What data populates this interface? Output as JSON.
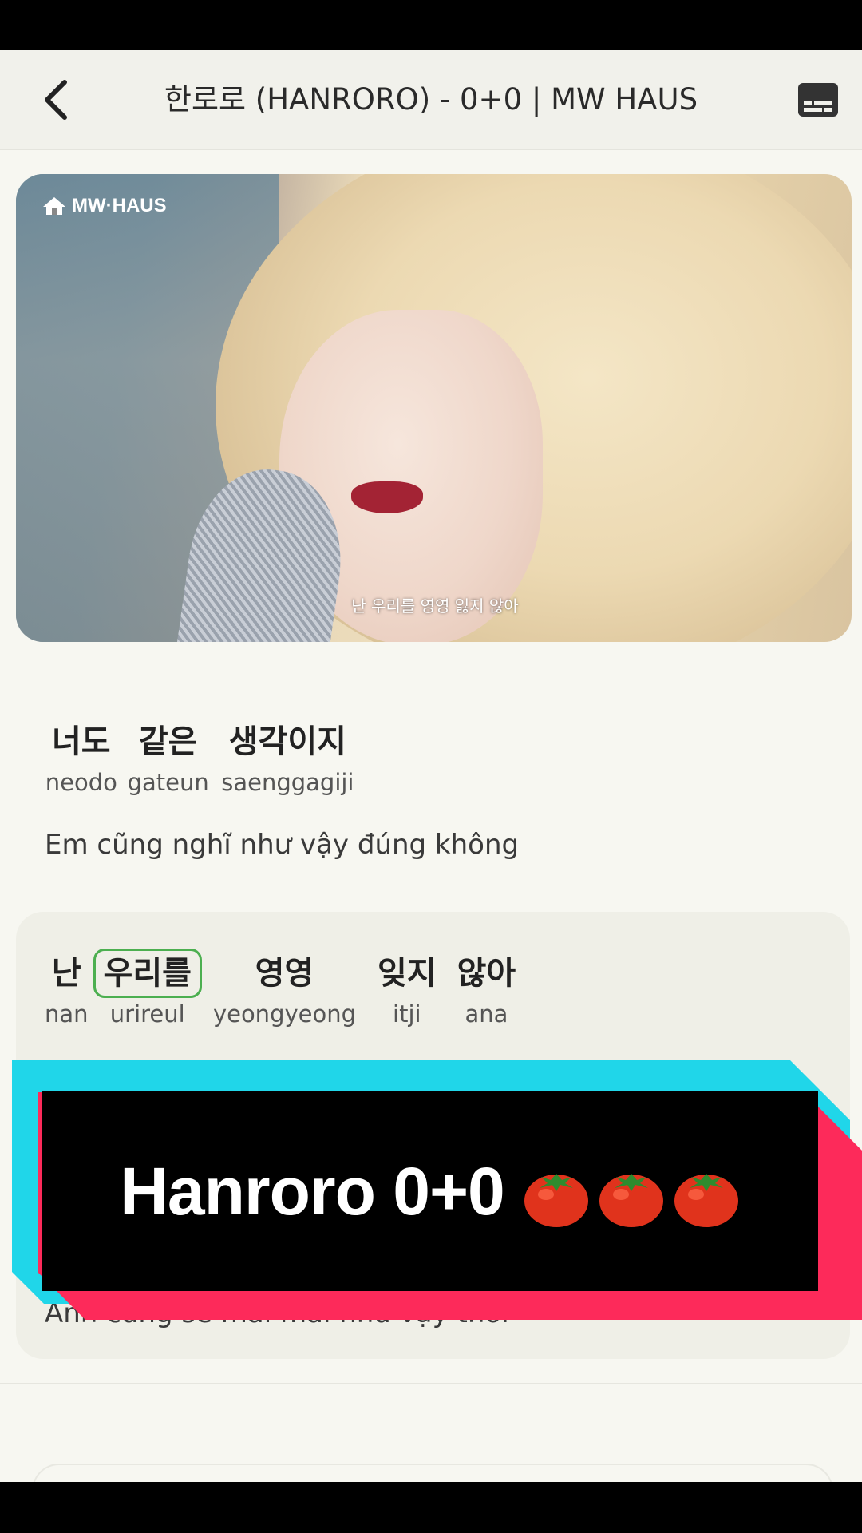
{
  "header": {
    "title": "한로로 (HANRORO) - 0+0 | MW HAUS"
  },
  "video": {
    "logo_text": "MW·HAUS",
    "caption": "난 우리를 영영 잃지 않아"
  },
  "lyrics": [
    {
      "words": [
        {
          "ko": "너도",
          "rom": "neodo"
        },
        {
          "ko": "같은",
          "rom": "gateun"
        },
        {
          "ko": "생각이지",
          "rom": "saenggagiji"
        }
      ],
      "translation": "Em cũng nghĩ như vậy đúng không"
    },
    {
      "words": [
        {
          "ko": "난",
          "rom": "nan"
        },
        {
          "ko": "우리를",
          "rom": "urireul"
        },
        {
          "ko": "영영",
          "rom": "yeongyeong"
        },
        {
          "ko": "잊지",
          "rom": "itji"
        },
        {
          "ko": "않아",
          "rom": "ana"
        }
      ],
      "active_index": 1,
      "translation_partial": "Anh cũng sẽ mãi mãi như vậy thôi"
    }
  ],
  "overlay": {
    "text": "Hanroro 0+0",
    "emoji_icons": [
      "tomato-icon",
      "tomato-icon",
      "tomato-icon"
    ],
    "colors": {
      "cyan": "#20d6e9",
      "red": "#fd2a5a",
      "black": "#000000"
    }
  },
  "colors": {
    "background": "#f7f7f1",
    "active_word_border": "#4caf50"
  }
}
